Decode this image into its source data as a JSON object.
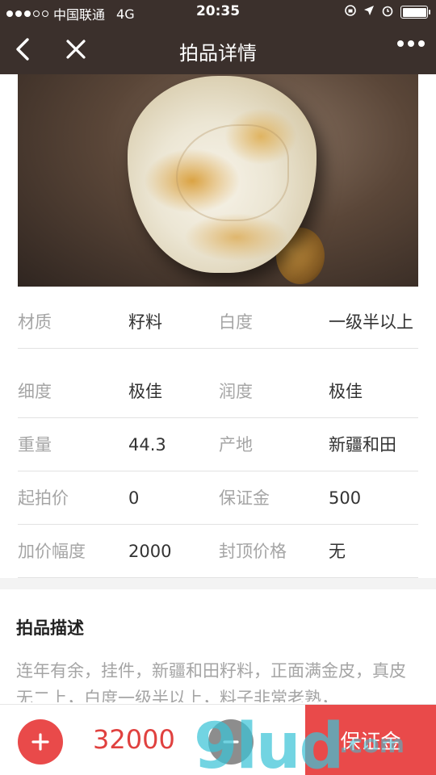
{
  "status_bar": {
    "carrier": "中国联通",
    "network": "4G",
    "time": "20:35"
  },
  "nav": {
    "title": "拍品详情"
  },
  "details": [
    {
      "label1": "材质",
      "value1": "籽料",
      "label2": "白度",
      "value2": "一级半以上"
    },
    {
      "label1": "细度",
      "value1": "极佳",
      "label2": "润度",
      "value2": "极佳"
    },
    {
      "label1": "重量",
      "value1": "44.3",
      "label2": "产地",
      "value2": "新疆和田"
    },
    {
      "label1": "起拍价",
      "value1": "0",
      "label2": "保证金",
      "value2": "500"
    },
    {
      "label1": "加价幅度",
      "value1": "2000",
      "label2": "封顶价格",
      "value2": "无"
    }
  ],
  "description": {
    "title": "拍品描述",
    "text": "连年有余，挂件，新疆和田籽料，正面满金皮，真皮无二上，白度一级半以上，料子非常老熟，"
  },
  "bottom_bar": {
    "plus_label": "+",
    "bid_amount": "32000",
    "minus_label": "-",
    "deposit_label": "保证金"
  },
  "watermark": {
    "main": "9lud",
    "suffix": ".com"
  },
  "colors": {
    "header_bg": "#3b302c",
    "accent_red": "#e94a4a",
    "price_red": "#e0413f",
    "minus_gray": "#8d8d8d"
  }
}
